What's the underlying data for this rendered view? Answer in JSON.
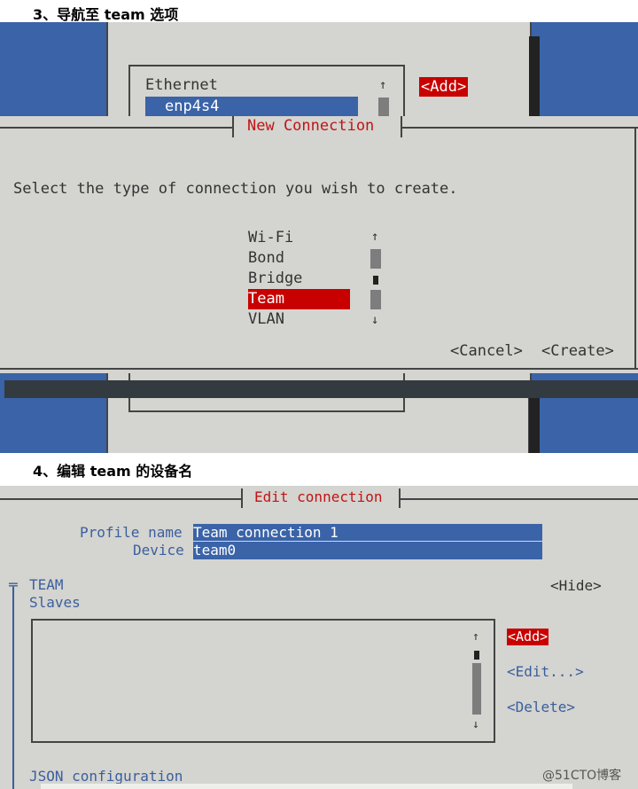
{
  "section3": {
    "heading": "3、导航至 team 选项",
    "background_list": {
      "header": "Ethernet",
      "selected_item": "enp4s4",
      "scroll_up": "↑",
      "add_button": "<Add>"
    },
    "dialog": {
      "title": "New Connection",
      "prompt": "Select the type of connection you wish to create.",
      "options": [
        "Wi-Fi",
        "Bond",
        "Bridge",
        "Team",
        "VLAN"
      ],
      "selected_option": "Team",
      "scroll_up": "↑",
      "scroll_down": "↓",
      "cancel_button": "<Cancel>",
      "create_button": "<Create>"
    }
  },
  "section4": {
    "heading": "4、编辑 team 的设备名",
    "title": "Edit connection",
    "profile_name_label": "Profile name",
    "profile_name_value": "Team connection 1",
    "device_label": "Device",
    "device_value": "team0",
    "team_label": "TEAM",
    "slaves_label": "Slaves",
    "hide_button": "<Hide>",
    "add_button": "<Add>",
    "edit_button": "<Edit...>",
    "delete_button": "<Delete>",
    "scroll_up": "↑",
    "scroll_down": "↓",
    "json_label": "JSON configuration",
    "collapse_marker": "╤"
  },
  "watermark": "@51CTO博客",
  "colors": {
    "terminal_blue": "#3a63a8",
    "dialog_grey": "#d4d4d0",
    "selection_red": "#c90000",
    "label_blue": "#3a5f9e"
  }
}
